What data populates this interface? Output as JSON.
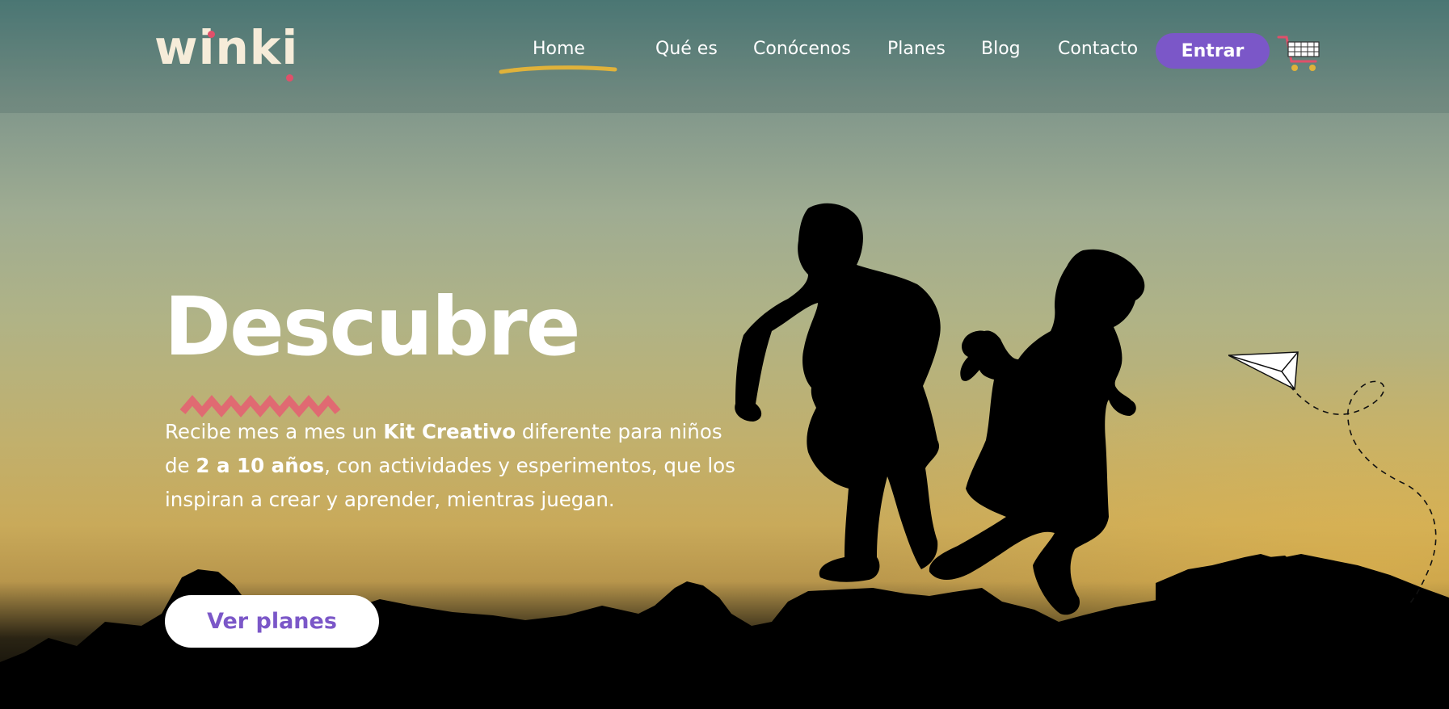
{
  "brand": {
    "logo_text": "winki"
  },
  "nav": {
    "items": [
      {
        "label": "Home",
        "active": true
      },
      {
        "label": "Qué es"
      },
      {
        "label": "Conócenos"
      },
      {
        "label": "Planes"
      },
      {
        "label": "Blog"
      },
      {
        "label": "Contacto"
      }
    ],
    "login_label": "Entrar",
    "cart_icon": "shopping-cart-icon"
  },
  "hero": {
    "title": "Descubre",
    "desc_part1": "Recibe mes a mes un ",
    "desc_bold1": "Kit Creativo",
    "desc_part2": " diferente para niños de ",
    "desc_bold2": "2 a 10 años",
    "desc_part3": ", con actividades y esperimentos, que los inspiran a crear y aprender, mientras juegan.",
    "cta_label": "Ver planes"
  },
  "colors": {
    "accent_purple": "#7b57c8",
    "underline_yellow": "#e0b23a",
    "zigzag_red": "#e06a72",
    "logo_dot": "#e0506a"
  }
}
